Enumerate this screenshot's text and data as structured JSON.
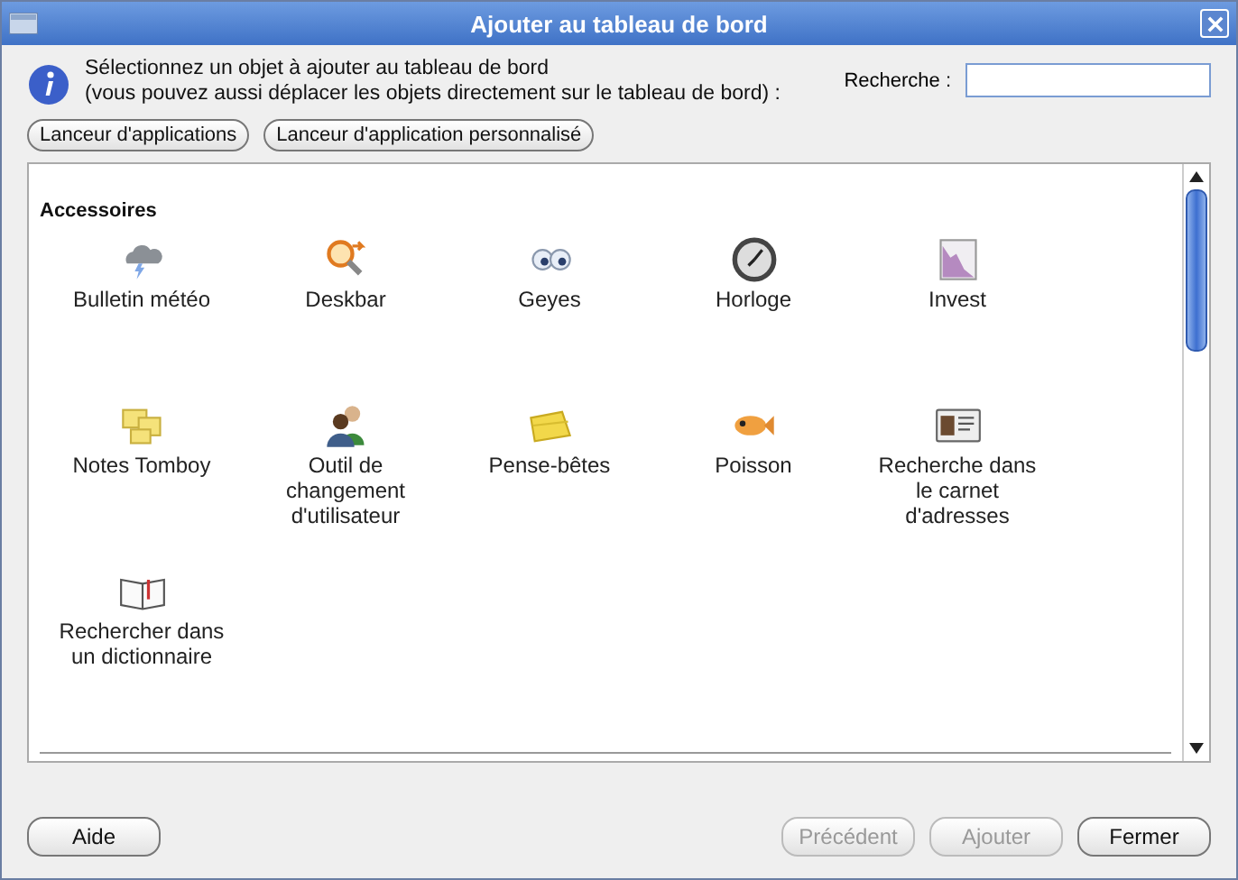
{
  "window": {
    "title": "Ajouter au tableau de bord"
  },
  "info": {
    "line_1": "Sélectionnez un objet à ajouter au tableau de bord",
    "line_2": "(vous pouvez aussi déplacer les objets directement sur le tableau de bord) :"
  },
  "search": {
    "label": "Recherche :"
  },
  "launchers": [
    "Lanceur d'applications",
    "Lanceur d'application personnalisé"
  ],
  "section": "Accessoires",
  "items": [
    {
      "label": "Bulletin météo",
      "kind": "weather"
    },
    {
      "label": "Deskbar",
      "kind": "deskbar"
    },
    {
      "label": "Geyes",
      "kind": "eyes"
    },
    {
      "label": "Horloge",
      "kind": "clock"
    },
    {
      "label": "Invest",
      "kind": "chart"
    },
    {
      "label": "Notes Tomboy",
      "kind": "notes"
    },
    {
      "label": "Outil de changement d'utilisateur",
      "kind": "users"
    },
    {
      "label": "Pense-bêtes",
      "kind": "sticky"
    },
    {
      "label": "Poisson",
      "kind": "fish"
    },
    {
      "label": "Recherche dans le carnet d'adresses",
      "kind": "card"
    },
    {
      "label": "Rechercher dans un dictionnaire",
      "kind": "book"
    }
  ],
  "buttons_left": [
    {
      "label": "Aide",
      "disabled": false
    }
  ],
  "buttons_right": [
    {
      "label": "Précédent",
      "disabled": true
    },
    {
      "label": "Ajouter",
      "disabled": true
    },
    {
      "label": "Fermer",
      "disabled": false
    }
  ]
}
